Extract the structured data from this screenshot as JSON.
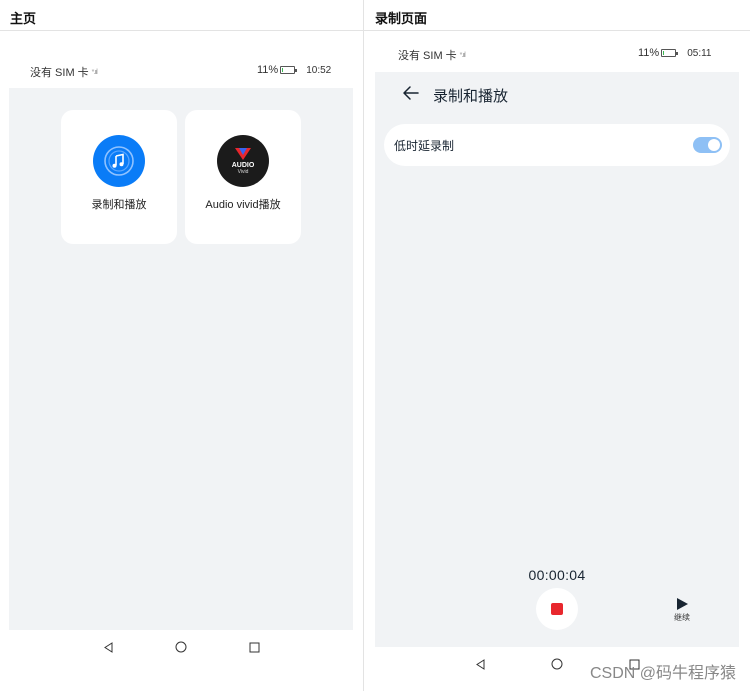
{
  "headers": {
    "left": "主页",
    "right": "录制页面"
  },
  "left_phone": {
    "status": {
      "carrier": "没有 SIM 卡",
      "signal": "*.ııl",
      "battery": "11%",
      "battery_level": 0.11,
      "time": "10:52"
    },
    "apps": [
      {
        "label": "录制和播放",
        "icon": "music-note-icon"
      },
      {
        "label": "Audio vivid播放",
        "icon": "audio-vivid-logo",
        "logo_text": "AUDIO",
        "logo_sub": "Vivid"
      }
    ]
  },
  "right_phone": {
    "status": {
      "carrier": "没有 SIM 卡",
      "signal": "*.ııl",
      "battery": "11%",
      "battery_level": 0.11,
      "time": "05:11"
    },
    "title": "录制和播放",
    "setting": {
      "label": "低时延录制",
      "enabled": true
    },
    "timer": "00:00:04",
    "continue_label": "继续"
  },
  "watermark": "CSDN @码牛程序猿",
  "colors": {
    "accent": "#0a7cf7",
    "stop": "#e8272d",
    "toggle_on": "#8ec0f5",
    "screen_bg": "#f1f3f5"
  }
}
